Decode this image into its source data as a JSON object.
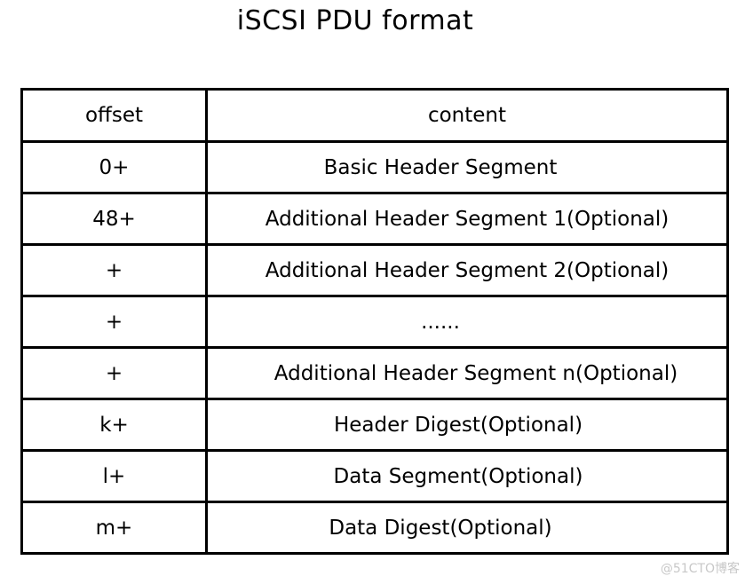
{
  "title": "iSCSI PDU format",
  "table": {
    "headers": {
      "offset": "offset",
      "content": "content"
    },
    "rows": [
      {
        "offset": "0+",
        "content": "Basic Header Segment"
      },
      {
        "offset": "48+",
        "content": "Additional Header Segment 1(Optional)"
      },
      {
        "offset": "+",
        "content": "Additional Header Segment 2(Optional)"
      },
      {
        "offset": "+",
        "content": "......"
      },
      {
        "offset": "+",
        "content": "Additional Header Segment n(Optional)"
      },
      {
        "offset": "k+",
        "content": "Header Digest(Optional)"
      },
      {
        "offset": "l+",
        "content": "Data Segment(Optional)"
      },
      {
        "offset": "m+",
        "content": "Data Digest(Optional)"
      }
    ]
  },
  "watermark": "@51CTO博客"
}
